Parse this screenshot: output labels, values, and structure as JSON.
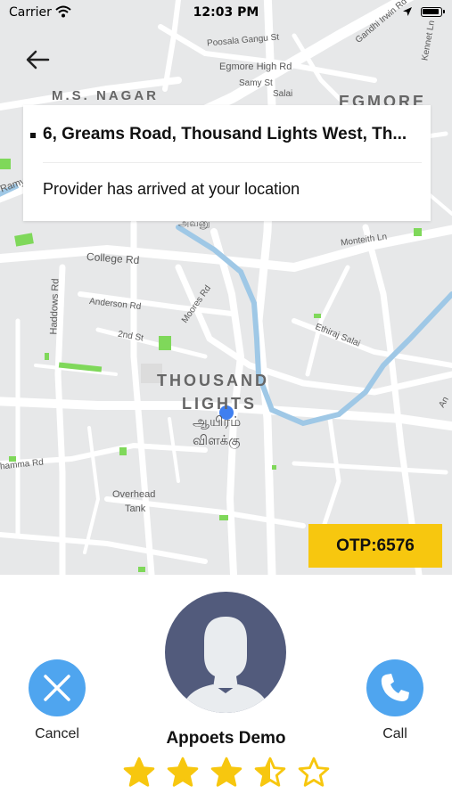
{
  "status_bar": {
    "carrier": "Carrier",
    "time": "12:03 PM"
  },
  "map": {
    "labels": {
      "ms_nagar": "M.S. NAGAR",
      "egmore": "EGMORE",
      "poosala": "Poosala Gangu St",
      "egmore_high_rd": "Egmore High Rd",
      "samy_st": "Samy St",
      "salai": "Salai",
      "gandhi_irwin": "Gandhi Irwin Rd",
      "kennet_ln": "Kennet Ln",
      "ramy": "Ramy",
      "avenue_tamil": "அவனு",
      "college_rd": "College Rd",
      "monteith_ln": "Monteith Ln",
      "haddows_rd": "Haddows Rd",
      "anderson_rd": "Anderson Rd",
      "moores_rd": "Moores Rd",
      "second_st": "2nd St",
      "ethiraj_salai": "Ethiraj Salai",
      "thousand_1": "THOUSAND",
      "thousand_2": "LIGHTS",
      "tamil_1": "ஆயிரம்",
      "tamil_2": "விளக்கு",
      "nungambakkam": "hamma Rd",
      "overhead_1": "Overhead",
      "overhead_2": "Tank",
      "anna_salai": "An"
    }
  },
  "trip": {
    "address": "6, Greams Road, Thousand Lights West, Th...",
    "status_message": "Provider has arrived at your location",
    "otp": "OTP:6576"
  },
  "actions": {
    "cancel_label": "Cancel",
    "call_label": "Call"
  },
  "driver": {
    "name": "Appoets Demo",
    "rating": 3.5,
    "max_rating": 5
  },
  "colors": {
    "star": "#f7c70f",
    "action_button": "#4fa5ef",
    "avatar_bg": "#525b7c",
    "otp_bg": "#f7c70f",
    "river": "#9fc8e6",
    "park": "#7fd85a",
    "location_dot": "#3f7ff0"
  }
}
